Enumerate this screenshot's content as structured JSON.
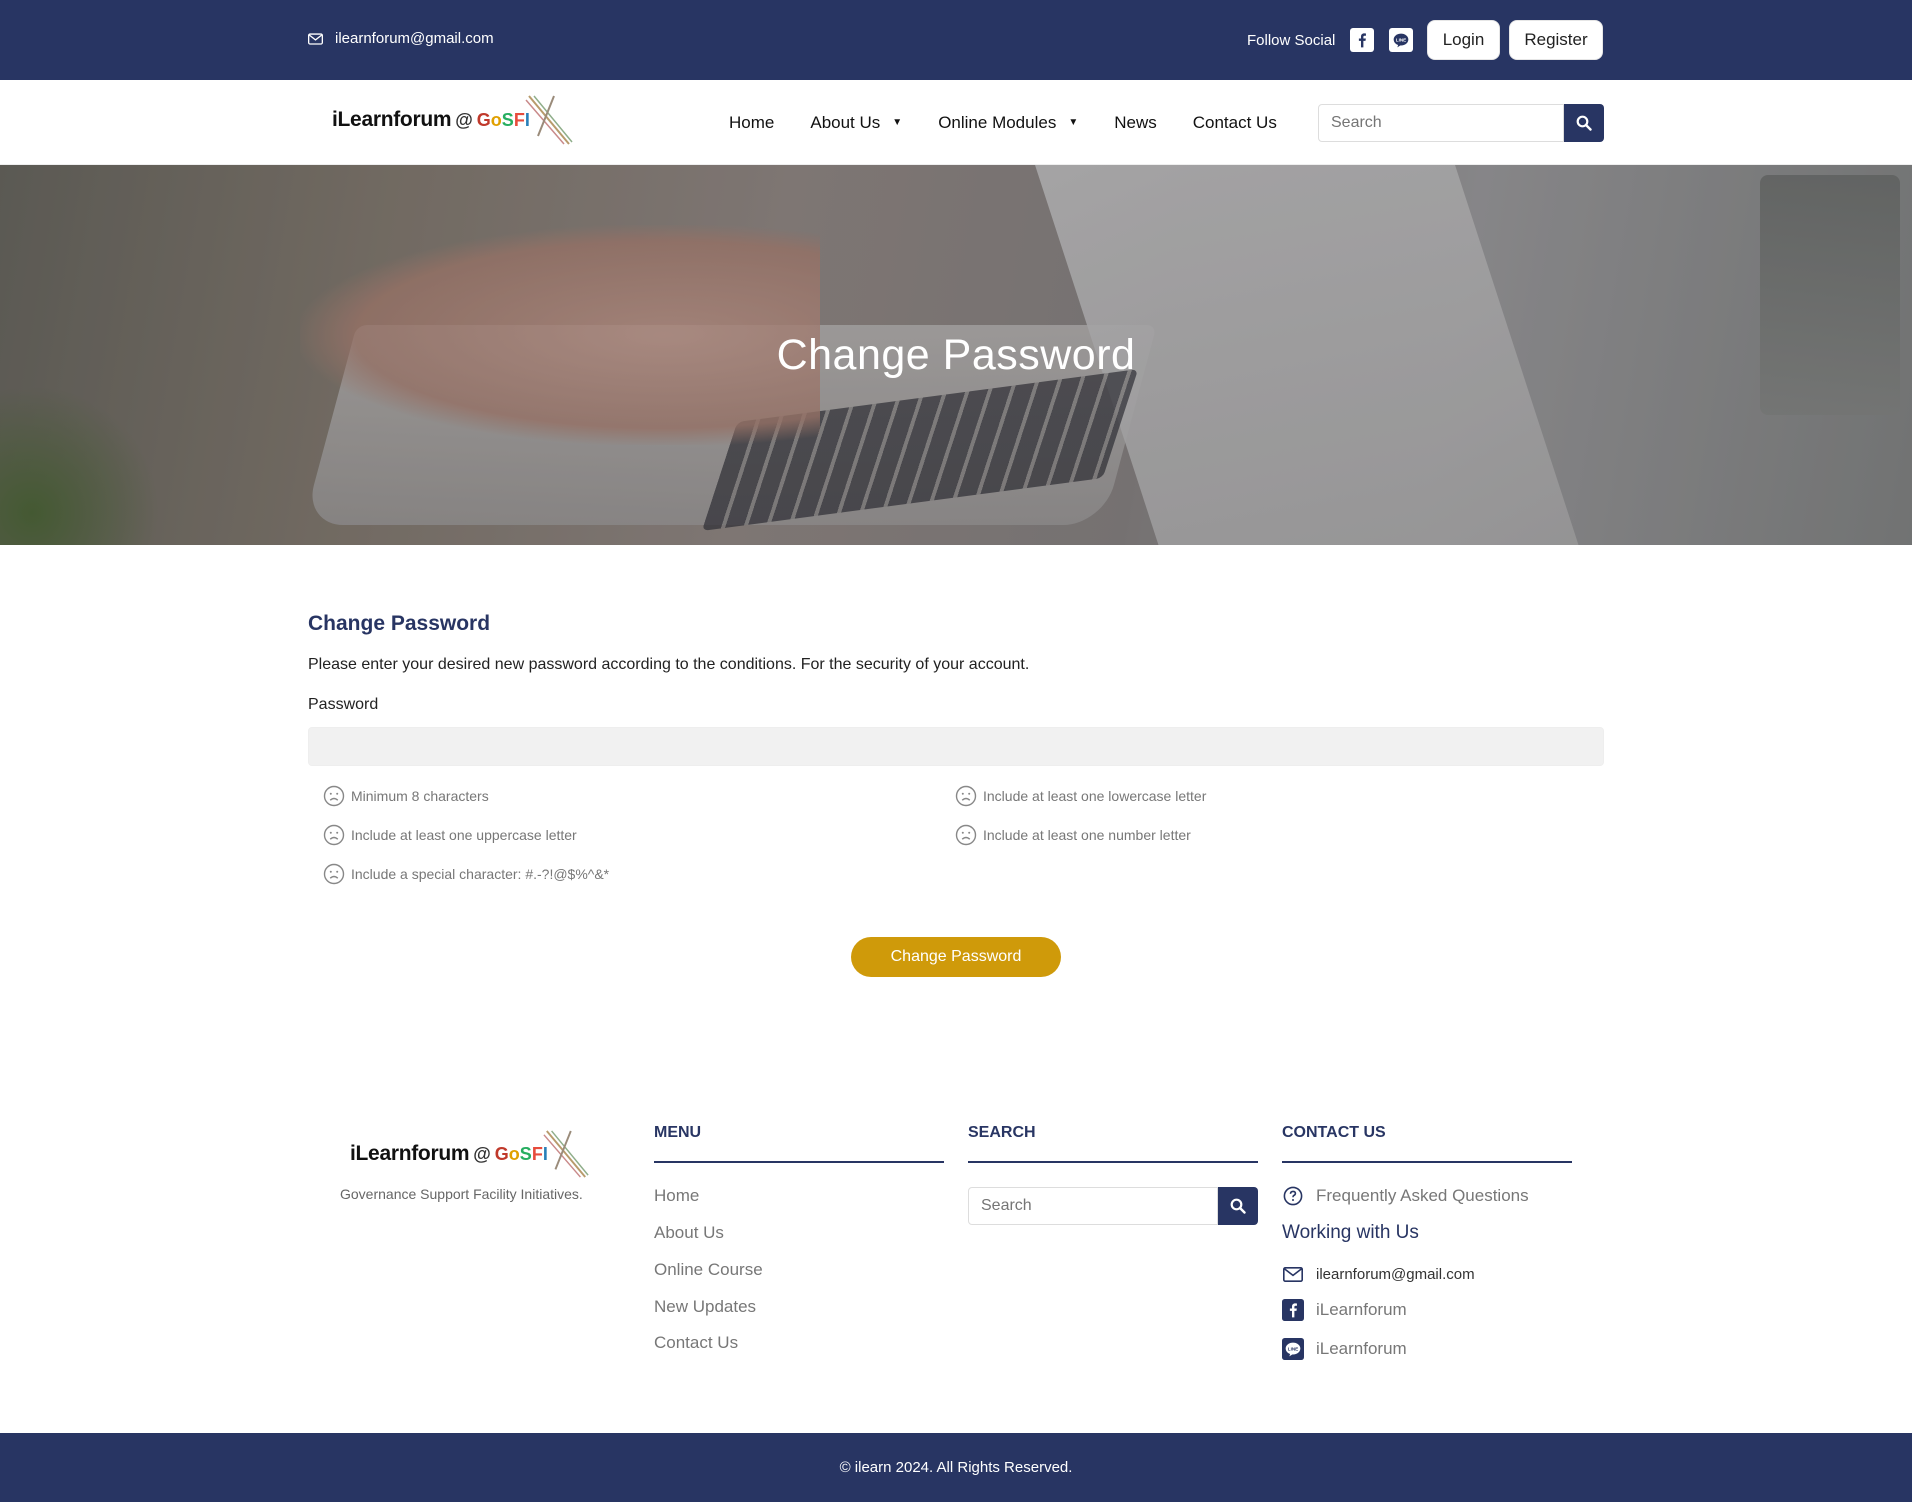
{
  "topbar": {
    "email": "ilearnforum@gmail.com",
    "follow_label": "Follow Social",
    "login_label": "Login",
    "register_label": "Register"
  },
  "brand": {
    "name": "iLearnforum",
    "at": "@",
    "suffix_parts": [
      "G",
      "o",
      "S",
      "F",
      "I"
    ]
  },
  "nav": {
    "items": [
      {
        "label": "Home",
        "dropdown": false
      },
      {
        "label": "About Us",
        "dropdown": true
      },
      {
        "label": "Online Modules",
        "dropdown": true
      },
      {
        "label": "News",
        "dropdown": false
      },
      {
        "label": "Contact Us",
        "dropdown": false
      }
    ],
    "search_placeholder": "Search"
  },
  "hero": {
    "title": "Change Password"
  },
  "form": {
    "title": "Change Password",
    "description": "Please enter your desired new password according to the conditions. For the security of your account.",
    "password_label": "Password",
    "password_value": "",
    "rules": [
      "Minimum 8 characters",
      "Include at least one lowercase letter",
      "Include at least one uppercase letter",
      "Include at least one number letter",
      "Include a special character: #.-?!@$%^&*"
    ],
    "submit_label": "Change Password"
  },
  "footer": {
    "tagline": "Governance Support Facility Initiatives.",
    "menu_title": "MENU",
    "menu_items": [
      "Home",
      "About Us",
      "Online Course",
      "New Updates",
      "Contact Us"
    ],
    "search_title": "SEARCH",
    "search_placeholder": "Search",
    "contact_title": "CONTACT US",
    "faq": "Frequently Asked Questions",
    "working_with_us": "Working with Us",
    "email": "ilearnforum@gmail.com",
    "facebook": "iLearnforum",
    "line": "iLearnforum",
    "copyright": "© ilearn 2024. All Rights Reserved."
  },
  "colors": {
    "navy": "#283563",
    "gold": "#cf9a0a"
  }
}
